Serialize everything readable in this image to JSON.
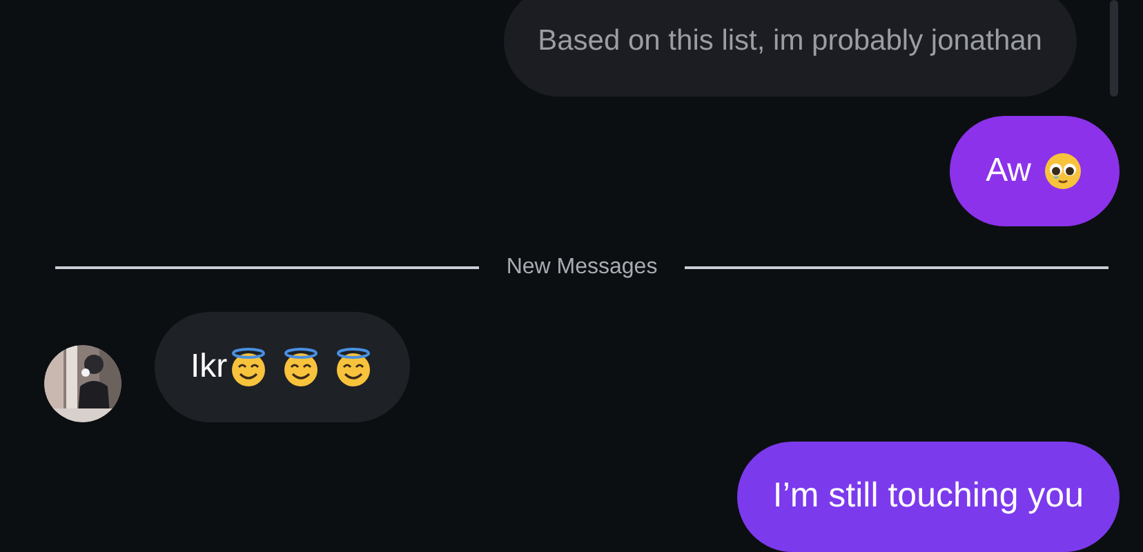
{
  "messages": [
    {
      "kind": "quoted",
      "parts": [
        {
          "kind": "text",
          "text": "Based on this list, im probably jonathan"
        }
      ]
    },
    {
      "kind": "sent",
      "parts": [
        {
          "kind": "text",
          "text": "Aw"
        },
        {
          "kind": "pleading"
        }
      ]
    },
    {
      "kind": "divider",
      "text": "New Messages"
    },
    {
      "kind": "received",
      "avatar": {
        "kind": "picture"
      },
      "parts": [
        {
          "kind": "text",
          "text": "Ikr"
        },
        {
          "kind": "halo"
        },
        {
          "kind": "halo"
        },
        {
          "kind": "halo"
        }
      ]
    },
    {
      "kind": "sent",
      "parts": [
        {
          "kind": "text",
          "text": "I’m still touching you"
        }
      ]
    }
  ]
}
